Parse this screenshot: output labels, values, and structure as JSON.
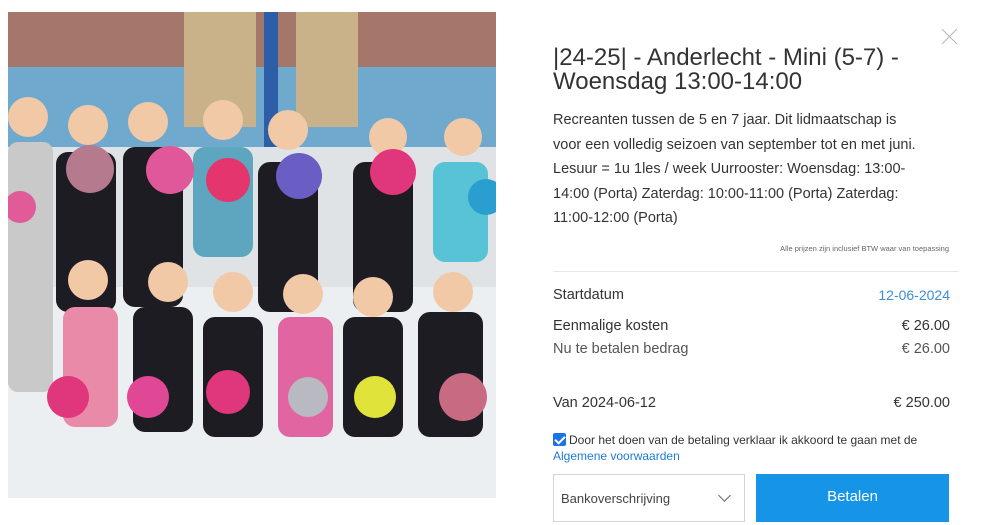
{
  "product": {
    "title": "|24-25| - Anderlecht - Mini (5-7) - Woensdag 13:00-14:00",
    "description": "Recreanten tussen de 5 en 7 jaar. Dit lidmaatschap is voor een volledig seizoen van september tot en met juni. Lesuur = 1u 1les / week Uurrooster: Woensdag: 13:00-14:00 (Porta) Zaterdag: 10:00-11:00 (Porta) Zaterdag: 11:00-12:00 (Porta)",
    "vat_note": "Alle prijzen zijn inclusief BTW waar van toepassing"
  },
  "pricing": {
    "start_label": "Startdatum",
    "start_value": "12-06-2024",
    "once_label": "Eenmalige kosten",
    "once_value": "€ 26.00",
    "now_label": "Nu te betalen bedrag",
    "now_value": "€ 26.00",
    "from_label": "Van 2024-06-12",
    "from_value": "€ 250.00"
  },
  "terms": {
    "checked": true,
    "text": "Door het doen van de betaling verklaar ik akkoord te gaan met de",
    "link": "Algemene voorwaarden"
  },
  "payment": {
    "method": "Bankoverschrijving",
    "pay_label": "Betalen"
  },
  "colors": {
    "accent": "#1594e8",
    "link": "#1e7bd8"
  },
  "icons": {
    "close": "close-icon",
    "chevron": "chevron-down-icon",
    "checkbox": "checkbox-checked-icon"
  }
}
